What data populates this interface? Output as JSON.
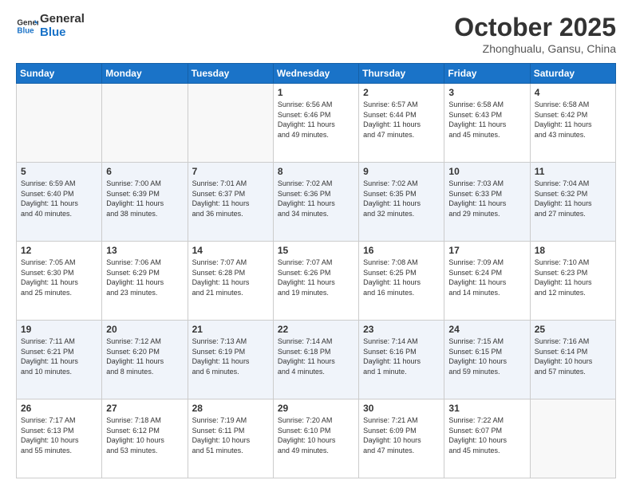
{
  "header": {
    "logo_line1": "General",
    "logo_line2": "Blue",
    "month_title": "October 2025",
    "location": "Zhonghualu, Gansu, China"
  },
  "days_of_week": [
    "Sunday",
    "Monday",
    "Tuesday",
    "Wednesday",
    "Thursday",
    "Friday",
    "Saturday"
  ],
  "weeks": [
    [
      {
        "num": "",
        "info": ""
      },
      {
        "num": "",
        "info": ""
      },
      {
        "num": "",
        "info": ""
      },
      {
        "num": "1",
        "info": "Sunrise: 6:56 AM\nSunset: 6:46 PM\nDaylight: 11 hours\nand 49 minutes."
      },
      {
        "num": "2",
        "info": "Sunrise: 6:57 AM\nSunset: 6:44 PM\nDaylight: 11 hours\nand 47 minutes."
      },
      {
        "num": "3",
        "info": "Sunrise: 6:58 AM\nSunset: 6:43 PM\nDaylight: 11 hours\nand 45 minutes."
      },
      {
        "num": "4",
        "info": "Sunrise: 6:58 AM\nSunset: 6:42 PM\nDaylight: 11 hours\nand 43 minutes."
      }
    ],
    [
      {
        "num": "5",
        "info": "Sunrise: 6:59 AM\nSunset: 6:40 PM\nDaylight: 11 hours\nand 40 minutes."
      },
      {
        "num": "6",
        "info": "Sunrise: 7:00 AM\nSunset: 6:39 PM\nDaylight: 11 hours\nand 38 minutes."
      },
      {
        "num": "7",
        "info": "Sunrise: 7:01 AM\nSunset: 6:37 PM\nDaylight: 11 hours\nand 36 minutes."
      },
      {
        "num": "8",
        "info": "Sunrise: 7:02 AM\nSunset: 6:36 PM\nDaylight: 11 hours\nand 34 minutes."
      },
      {
        "num": "9",
        "info": "Sunrise: 7:02 AM\nSunset: 6:35 PM\nDaylight: 11 hours\nand 32 minutes."
      },
      {
        "num": "10",
        "info": "Sunrise: 7:03 AM\nSunset: 6:33 PM\nDaylight: 11 hours\nand 29 minutes."
      },
      {
        "num": "11",
        "info": "Sunrise: 7:04 AM\nSunset: 6:32 PM\nDaylight: 11 hours\nand 27 minutes."
      }
    ],
    [
      {
        "num": "12",
        "info": "Sunrise: 7:05 AM\nSunset: 6:30 PM\nDaylight: 11 hours\nand 25 minutes."
      },
      {
        "num": "13",
        "info": "Sunrise: 7:06 AM\nSunset: 6:29 PM\nDaylight: 11 hours\nand 23 minutes."
      },
      {
        "num": "14",
        "info": "Sunrise: 7:07 AM\nSunset: 6:28 PM\nDaylight: 11 hours\nand 21 minutes."
      },
      {
        "num": "15",
        "info": "Sunrise: 7:07 AM\nSunset: 6:26 PM\nDaylight: 11 hours\nand 19 minutes."
      },
      {
        "num": "16",
        "info": "Sunrise: 7:08 AM\nSunset: 6:25 PM\nDaylight: 11 hours\nand 16 minutes."
      },
      {
        "num": "17",
        "info": "Sunrise: 7:09 AM\nSunset: 6:24 PM\nDaylight: 11 hours\nand 14 minutes."
      },
      {
        "num": "18",
        "info": "Sunrise: 7:10 AM\nSunset: 6:23 PM\nDaylight: 11 hours\nand 12 minutes."
      }
    ],
    [
      {
        "num": "19",
        "info": "Sunrise: 7:11 AM\nSunset: 6:21 PM\nDaylight: 11 hours\nand 10 minutes."
      },
      {
        "num": "20",
        "info": "Sunrise: 7:12 AM\nSunset: 6:20 PM\nDaylight: 11 hours\nand 8 minutes."
      },
      {
        "num": "21",
        "info": "Sunrise: 7:13 AM\nSunset: 6:19 PM\nDaylight: 11 hours\nand 6 minutes."
      },
      {
        "num": "22",
        "info": "Sunrise: 7:14 AM\nSunset: 6:18 PM\nDaylight: 11 hours\nand 4 minutes."
      },
      {
        "num": "23",
        "info": "Sunrise: 7:14 AM\nSunset: 6:16 PM\nDaylight: 11 hours\nand 1 minute."
      },
      {
        "num": "24",
        "info": "Sunrise: 7:15 AM\nSunset: 6:15 PM\nDaylight: 10 hours\nand 59 minutes."
      },
      {
        "num": "25",
        "info": "Sunrise: 7:16 AM\nSunset: 6:14 PM\nDaylight: 10 hours\nand 57 minutes."
      }
    ],
    [
      {
        "num": "26",
        "info": "Sunrise: 7:17 AM\nSunset: 6:13 PM\nDaylight: 10 hours\nand 55 minutes."
      },
      {
        "num": "27",
        "info": "Sunrise: 7:18 AM\nSunset: 6:12 PM\nDaylight: 10 hours\nand 53 minutes."
      },
      {
        "num": "28",
        "info": "Sunrise: 7:19 AM\nSunset: 6:11 PM\nDaylight: 10 hours\nand 51 minutes."
      },
      {
        "num": "29",
        "info": "Sunrise: 7:20 AM\nSunset: 6:10 PM\nDaylight: 10 hours\nand 49 minutes."
      },
      {
        "num": "30",
        "info": "Sunrise: 7:21 AM\nSunset: 6:09 PM\nDaylight: 10 hours\nand 47 minutes."
      },
      {
        "num": "31",
        "info": "Sunrise: 7:22 AM\nSunset: 6:07 PM\nDaylight: 10 hours\nand 45 minutes."
      },
      {
        "num": "",
        "info": ""
      }
    ]
  ]
}
